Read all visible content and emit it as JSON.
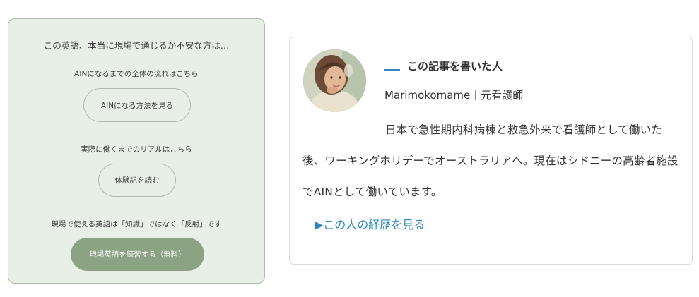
{
  "left_card": {
    "heading": "この英語、本当に現場で通じるか不安な方は…",
    "section1": {
      "label": "AINになるまでの全体の流れはこちら",
      "button": "AINになる方法を見る"
    },
    "section2": {
      "label": "実際に働くまでのリアルはこちら",
      "button": "体験記を読む"
    },
    "section3": {
      "label": "現場で使える英語は「知識」ではなく「反射」です",
      "button": "現場英語を練習する（無料）"
    }
  },
  "author_card": {
    "title": "この記事を書いた人",
    "name": "Marimokomame｜元看護師",
    "bio": "日本で急性期内科病棟と救急外来で看護師として働いた後、ワーキングホリデーでオーストラリアへ。現在はシドニーの高齢者施設でAINとして働いています。",
    "link": "▶この人の経歴を見る"
  },
  "colors": {
    "card_green": "#e8efe6",
    "button_green": "#8ca383",
    "accent_blue": "#2a89b8"
  }
}
